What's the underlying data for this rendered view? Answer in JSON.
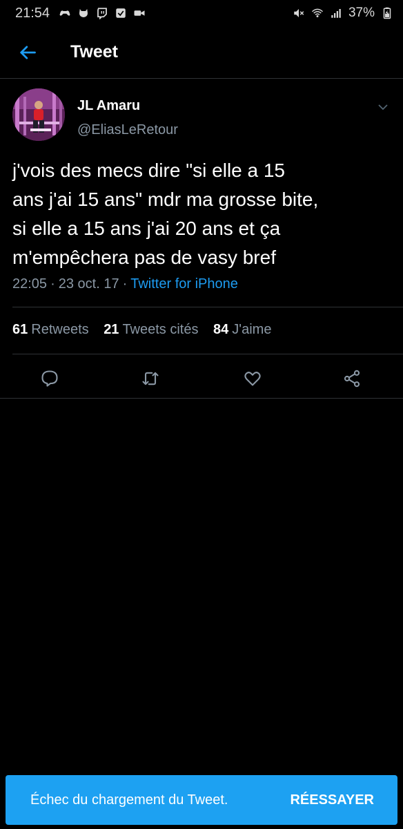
{
  "status_bar": {
    "time": "21:54",
    "battery": "37%",
    "left_icons": [
      "game-controller-icon",
      "cat-icon",
      "twitch-icon",
      "checkbox-icon",
      "video-camera-icon"
    ],
    "right_icons": [
      "mute-icon",
      "wifi-icon",
      "signal-icon",
      "battery-icon"
    ]
  },
  "header": {
    "title": "Tweet",
    "back_icon": "back-arrow-icon"
  },
  "tweet": {
    "author": {
      "display_name": "JL Amaru",
      "handle": "@EliasLeRetour"
    },
    "text": "j'vois des mecs dire \"si elle a 15\nans j'ai 15 ans\" mdr ma grosse bite,\nsi elle a 15 ans j'ai 20 ans et ça\nm'empêchera pas de vasy bref",
    "time": "22:05",
    "date": "23 oct. 17",
    "source": "Twitter for iPhone",
    "separator": "·",
    "stats": {
      "retweets_count": "61",
      "retweets_label": "Retweets",
      "quotes_count": "21",
      "quotes_label": "Tweets cités",
      "likes_count": "84",
      "likes_label": "J'aime"
    },
    "actions": [
      "reply-icon",
      "retweet-icon",
      "like-icon",
      "share-icon"
    ]
  },
  "snackbar": {
    "message": "Échec du chargement du Tweet.",
    "action": "RÉESSAYER"
  },
  "colors": {
    "background": "#000000",
    "accent": "#1d9bf0",
    "snackbar": "#1da1f2",
    "secondary_text": "#8b98a5",
    "divider": "#2f3336"
  }
}
